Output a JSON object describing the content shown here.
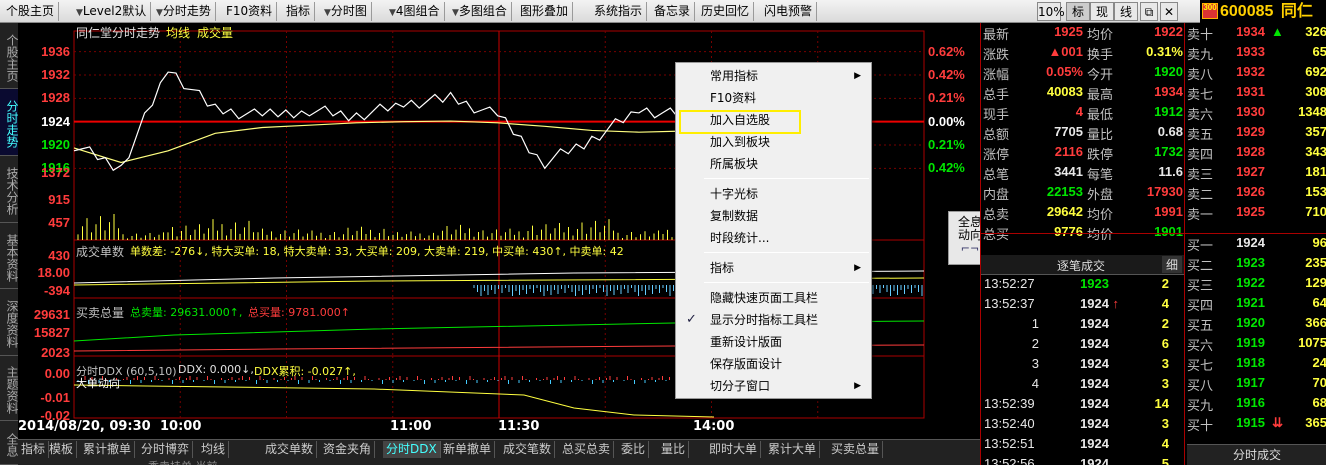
{
  "toolbar": {
    "items": [
      {
        "label": "个股主页",
        "arrow": false
      },
      {
        "label": "Level2默认",
        "arrow": true
      },
      {
        "label": "分时走势",
        "arrow": true
      },
      {
        "label": "F10资料",
        "arrow": false
      },
      {
        "label": "指标",
        "arrow": false
      },
      {
        "label": "分时图",
        "arrow": true
      },
      {
        "label": "4图组合",
        "arrow": true
      },
      {
        "label": "多图组合",
        "arrow": true
      },
      {
        "label": "图形叠加",
        "arrow": false
      },
      {
        "label": "系统指示",
        "arrow": false
      },
      {
        "label": "备忘录",
        "arrow": false
      },
      {
        "label": "历史回忆",
        "arrow": false
      },
      {
        "label": "闪电预警",
        "arrow": false
      }
    ],
    "right": [
      "10%",
      "标",
      "现",
      "线"
    ],
    "stock_code": "600085",
    "stock_name": "同仁堂",
    "logo_text": "300"
  },
  "left_tabs": [
    "个股主页",
    "分时走势",
    "技术分析",
    "基本资料",
    "深度资料",
    "主题资料",
    "全息"
  ],
  "chart": {
    "title": "同仁堂分时走势",
    "legend": [
      "均线",
      "成交量"
    ],
    "price_labels": [
      "1936",
      "1932",
      "1928",
      "1924",
      "1920",
      "1916"
    ],
    "price_colors": [
      "red",
      "red",
      "red",
      "white",
      "green",
      "green"
    ],
    "pct_labels": [
      "0.62%",
      "0.42%",
      "0.21%",
      "0.00%",
      "0.21%",
      "0.42%"
    ],
    "vol_labels": [
      "1372",
      "915",
      "457"
    ],
    "panel2": {
      "label": "成交单数",
      "text": "单数差: -276↓, 特大买单: 18, 特大卖单: 33, 大买单: 209, 大卖单: 219, 中买单: 430↑, 中卖单: 42",
      "y_labels": [
        "430",
        "18.00",
        "-394"
      ]
    },
    "panel3": {
      "label": "买卖总量",
      "sell": "总卖量: 29631.000↑,",
      "buy": "总买量: 9781.000↑",
      "y_labels": [
        "29631",
        "15827",
        "2023"
      ]
    },
    "panel4": {
      "label": "分时DDX (60,5,10)",
      "ddx": "DDX: 0.000↓,",
      "ddx_cum": "DDX累积: -0.027↑,",
      "sub": "大单动向",
      "y_labels": [
        "0.00",
        "-0.01",
        "-0.02"
      ]
    },
    "time_labels": [
      "2014/08/20, 09:30",
      "10:00",
      "11:00",
      "11:30",
      "14:00"
    ],
    "quanxi": [
      "全息",
      "动向"
    ]
  },
  "chart_data": {
    "type": "line",
    "title": "同仁堂分时走势",
    "series": [
      {
        "name": "均线",
        "color": "#ffff80",
        "values": [
          1919.5,
          1917,
          1919,
          1922,
          1923,
          1923.4,
          1923.8,
          1924,
          1924.1,
          1923.8,
          1923.2,
          1922.5,
          1922.2,
          1922.4
        ]
      },
      {
        "name": "price",
        "color": "#ffffff",
        "values": [
          1920,
          1916,
          1933,
          1926,
          1925,
          1926,
          1925,
          1927,
          1928,
          1925,
          1917,
          1921,
          1926,
          1925
        ]
      }
    ],
    "x": [
      "09:30",
      "09:50",
      "10:00",
      "10:15",
      "10:30",
      "10:45",
      "11:00",
      "11:10",
      "11:20",
      "11:30",
      "13:15",
      "13:30",
      "13:45",
      "14:00"
    ],
    "ylim": [
      1914,
      1938
    ],
    "volume_values": [
      1372,
      400,
      900,
      1100,
      600,
      500,
      700,
      450,
      800,
      600,
      900,
      1100,
      500,
      700
    ]
  },
  "context_menu": {
    "items": [
      {
        "label": "常用指标",
        "sub": true,
        "check": false
      },
      {
        "label": "F10资料",
        "sub": false,
        "check": false
      },
      {
        "label": "加入自选股",
        "sub": false,
        "check": false
      },
      {
        "label": "加入到板块",
        "sub": false,
        "check": false
      },
      {
        "label": "所属板块",
        "sub": false,
        "check": false
      },
      {
        "label": "十字光标",
        "sub": false,
        "check": false
      },
      {
        "label": "复制数据",
        "sub": false,
        "check": false
      },
      {
        "label": "时段统计...",
        "sub": false,
        "check": false
      },
      {
        "label": "指标",
        "sub": true,
        "check": false
      },
      {
        "label": "隐藏快速页面工具栏",
        "sub": false,
        "check": false
      },
      {
        "label": "显示分时指标工具栏",
        "sub": false,
        "check": true
      },
      {
        "label": "重新设计版面",
        "sub": false,
        "check": false
      },
      {
        "label": "保存版面设计",
        "sub": false,
        "check": false
      },
      {
        "label": "切分子窗口",
        "sub": true,
        "check": false
      }
    ]
  },
  "quote": {
    "left_rows": [
      {
        "l1": "最新",
        "v1": "1925",
        "c1": "red",
        "l2": "均价",
        "v2": "1922",
        "c2": "red"
      },
      {
        "l1": "涨跌",
        "v1": "▲001",
        "c1": "red",
        "l2": "换手",
        "v2": "0.31%",
        "c2": "yel"
      },
      {
        "l1": "涨幅",
        "v1": "0.05%",
        "c1": "red",
        "l2": "今开",
        "v2": "1920",
        "c2": "grn"
      },
      {
        "l1": "总手",
        "v1": "40083",
        "c1": "yel",
        "l2": "最高",
        "v2": "1934",
        "c2": "red"
      },
      {
        "l1": "现手",
        "v1": "4",
        "c1": "red",
        "l2": "最低",
        "v2": "1912",
        "c2": "grn"
      },
      {
        "l1": "总额",
        "v1": "7705",
        "c1": "wht",
        "l2": "量比",
        "v2": "0.68",
        "c2": "wht"
      },
      {
        "l1": "涨停",
        "v1": "2116",
        "c1": "red",
        "l2": "跌停",
        "v2": "1732",
        "c2": "grn"
      },
      {
        "l1": "总笔",
        "v1": "3441",
        "c1": "wht",
        "l2": "每笔",
        "v2": "11.6",
        "c2": "wht"
      },
      {
        "l1": "内盘",
        "v1": "22153",
        "c1": "grn",
        "l2": "外盘",
        "v2": "17930",
        "c2": "red"
      },
      {
        "l1": "总卖",
        "v1": "29642",
        "c1": "yel",
        "l2": "均价",
        "v2": "1991",
        "c2": "red"
      },
      {
        "l1": "总买",
        "v1": "9776",
        "c1": "yel",
        "l2": "均价",
        "v2": "1901",
        "c2": "grn"
      }
    ],
    "sell_book": [
      {
        "label": "卖十",
        "price": "1934",
        "pc": "red",
        "vol": "326",
        "mark": "▲"
      },
      {
        "label": "卖九",
        "price": "1933",
        "pc": "red",
        "vol": "65",
        "mark": ""
      },
      {
        "label": "卖八",
        "price": "1932",
        "pc": "red",
        "vol": "692",
        "mark": ""
      },
      {
        "label": "卖七",
        "price": "1931",
        "pc": "red",
        "vol": "308",
        "mark": ""
      },
      {
        "label": "卖六",
        "price": "1930",
        "pc": "red",
        "vol": "1348",
        "mark": ""
      },
      {
        "label": "卖五",
        "price": "1929",
        "pc": "red",
        "vol": "357",
        "mark": ""
      },
      {
        "label": "卖四",
        "price": "1928",
        "pc": "red",
        "vol": "343",
        "mark": ""
      },
      {
        "label": "卖三",
        "price": "1927",
        "pc": "red",
        "vol": "181",
        "mark": ""
      },
      {
        "label": "卖二",
        "price": "1926",
        "pc": "red",
        "vol": "153",
        "mark": ""
      },
      {
        "label": "卖一",
        "price": "1925",
        "pc": "red",
        "vol": "710",
        "mark": ""
      }
    ],
    "buy_book": [
      {
        "label": "买一",
        "price": "1924",
        "pc": "wht",
        "vol": "96",
        "mark": ""
      },
      {
        "label": "买二",
        "price": "1923",
        "pc": "grn",
        "vol": "235",
        "mark": ""
      },
      {
        "label": "买三",
        "price": "1922",
        "pc": "grn",
        "vol": "129",
        "mark": ""
      },
      {
        "label": "买四",
        "price": "1921",
        "pc": "grn",
        "vol": "64",
        "mark": ""
      },
      {
        "label": "买五",
        "price": "1920",
        "pc": "grn",
        "vol": "366",
        "mark": ""
      },
      {
        "label": "买六",
        "price": "1919",
        "pc": "grn",
        "vol": "1075",
        "mark": ""
      },
      {
        "label": "买七",
        "price": "1918",
        "pc": "grn",
        "vol": "24",
        "mark": ""
      },
      {
        "label": "买八",
        "price": "1917",
        "pc": "grn",
        "vol": "70",
        "mark": ""
      },
      {
        "label": "买九",
        "price": "1916",
        "pc": "grn",
        "vol": "68",
        "mark": ""
      },
      {
        "label": "买十",
        "price": "1915",
        "pc": "grn",
        "vol": "365",
        "mark": "⇊"
      }
    ],
    "ticks_header": "逐笔成交",
    "ticks_header_btn": "细",
    "ticks": [
      {
        "t": "13:52:27",
        "p": "1923",
        "pc": "grn",
        "v": "2",
        "arrow": ""
      },
      {
        "t": "13:52:37",
        "p": "1924",
        "pc": "wht",
        "v": "4",
        "arrow": "↑"
      },
      {
        "t": "1",
        "p": "1924",
        "pc": "wht",
        "v": "2",
        "arrow": ""
      },
      {
        "t": "2",
        "p": "1924",
        "pc": "wht",
        "v": "6",
        "arrow": ""
      },
      {
        "t": "3",
        "p": "1924",
        "pc": "wht",
        "v": "3",
        "arrow": ""
      },
      {
        "t": "4",
        "p": "1924",
        "pc": "wht",
        "v": "3",
        "arrow": ""
      },
      {
        "t": "13:52:39",
        "p": "1924",
        "pc": "wht",
        "v": "14",
        "arrow": ""
      },
      {
        "t": "13:52:40",
        "p": "1924",
        "pc": "wht",
        "v": "3",
        "arrow": ""
      },
      {
        "t": "13:52:51",
        "p": "1924",
        "pc": "wht",
        "v": "4",
        "arrow": ""
      },
      {
        "t": "13:52:56",
        "p": "1924",
        "pc": "wht",
        "v": "5",
        "arrow": ""
      }
    ],
    "bottom_tab": "分时成交"
  },
  "bottom_tabs": [
    "指标",
    "模板",
    "累计撤单",
    "分时博弈",
    "均线",
    "成交单数",
    "资金夹角",
    "分时DDX",
    "新单撤单",
    "成交笔数",
    "总买总卖",
    "委比",
    "量比",
    "即时大单",
    "累计大单",
    "买卖总量"
  ],
  "bottom_status": "委卖挂单 当前..."
}
